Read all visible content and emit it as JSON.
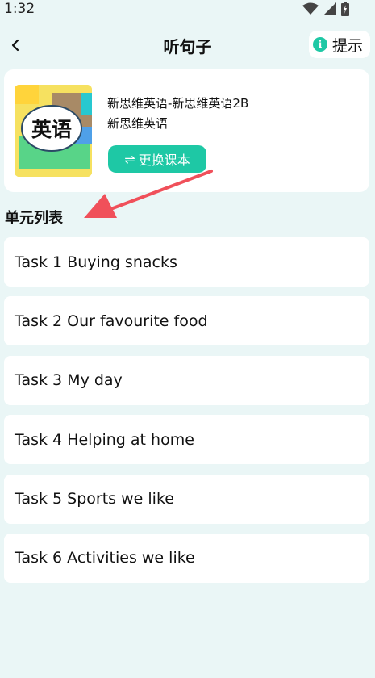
{
  "status_bar": {
    "time": "1:32",
    "icons": [
      "wifi-icon",
      "cellular-icon",
      "battery-icon"
    ]
  },
  "header": {
    "back_icon": "chevron-left-icon",
    "title": "听句子",
    "tip_icon": "info-icon",
    "tip_icon_glyph": "i",
    "tip_label": "提示"
  },
  "book": {
    "cover_text": "英语",
    "title": "新思维英语-新思维英语2B",
    "subtitle": "新思维英语",
    "change_button_icon": "swap-icon",
    "change_button_glyph": "⇌",
    "change_button_label": "更换课本"
  },
  "units": {
    "section_title": "单元列表",
    "items": [
      {
        "label": "Task 1 Buying snacks"
      },
      {
        "label": "Task 2 Our favourite food"
      },
      {
        "label": "Task 3 My day"
      },
      {
        "label": "Task 4 Helping at home"
      },
      {
        "label": "Task 5 Sports we like"
      },
      {
        "label": "Task 6 Activities we like"
      }
    ]
  },
  "colors": {
    "background": "#eaf6f6",
    "accent": "#1ec8a5",
    "annotation_arrow": "#f0505a"
  }
}
